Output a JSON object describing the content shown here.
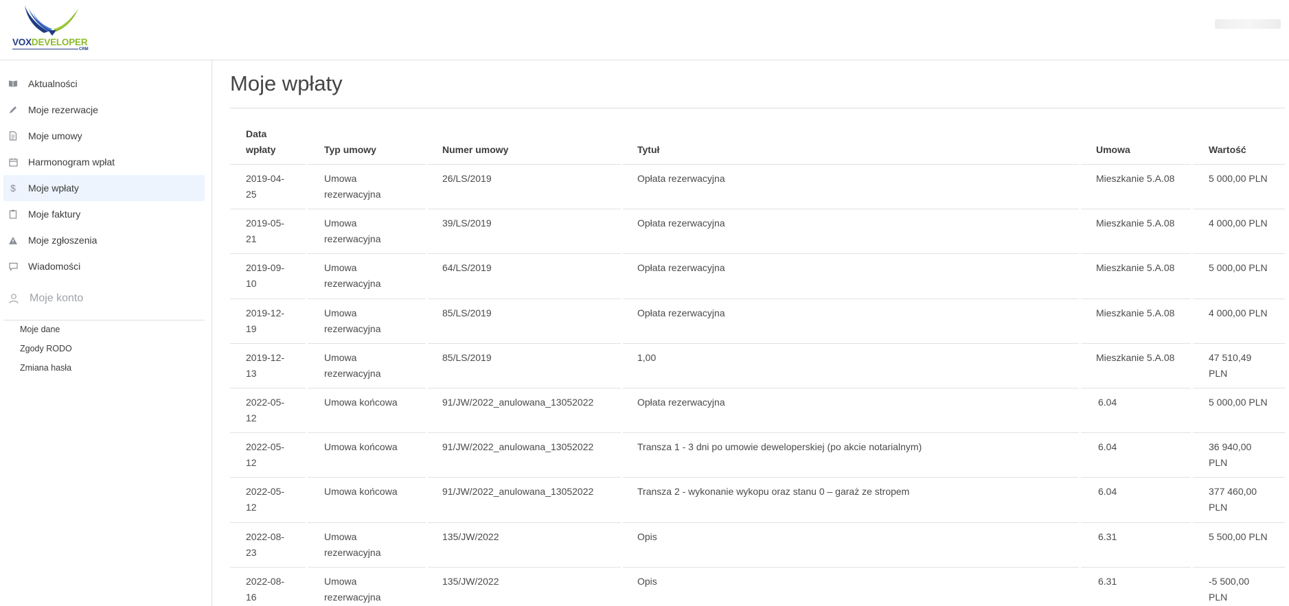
{
  "brand": {
    "part1": "VOX",
    "part2": "DEVELOPER",
    "sub": "CRM"
  },
  "sidebar": {
    "items": [
      {
        "label": "Aktualności",
        "icon": "book-icon"
      },
      {
        "label": "Moje rezerwacje",
        "icon": "pencil-icon"
      },
      {
        "label": "Moje umowy",
        "icon": "document-icon"
      },
      {
        "label": "Harmonogram wpłat",
        "icon": "calendar-icon"
      },
      {
        "label": "Moje wpłaty",
        "icon": "dollar-icon",
        "active": true
      },
      {
        "label": "Moje faktury",
        "icon": "clipboard-icon"
      },
      {
        "label": "Moje zgłoszenia",
        "icon": "warning-icon"
      },
      {
        "label": "Wiadomości",
        "icon": "chat-icon"
      }
    ],
    "account": {
      "label": "Moje konto",
      "icon": "user-icon",
      "items": [
        "Moje dane",
        "Zgody RODO",
        "Zmiana hasła"
      ]
    }
  },
  "main": {
    "title": "Moje wpłaty",
    "table": {
      "headers": {
        "date_line1": "Data",
        "date_line2": "wpłaty",
        "type": "Typ umowy",
        "number": "Numer umowy",
        "title": "Tytuł",
        "contract": "Umowa",
        "value": "Wartość"
      },
      "rows": [
        {
          "date1": "2019-04-",
          "date2": "25",
          "type1": "Umowa",
          "type2": "rezerwacyjna",
          "number": "26/LS/2019",
          "title": "Opłata rezerwacyjna",
          "contract": "Mieszkanie 5.A.08",
          "value1": "5 000,00 PLN",
          "value2": ""
        },
        {
          "date1": "2019-05-",
          "date2": "21",
          "type1": "Umowa",
          "type2": "rezerwacyjna",
          "number": "39/LS/2019",
          "title": "Opłata rezerwacyjna",
          "contract": "Mieszkanie 5.A.08",
          "value1": "4 000,00 PLN",
          "value2": ""
        },
        {
          "date1": "2019-09-",
          "date2": "10",
          "type1": "Umowa",
          "type2": "rezerwacyjna",
          "number": "64/LS/2019",
          "title": "Opłata rezerwacyjna",
          "contract": "Mieszkanie 5.A.08",
          "value1": "5 000,00 PLN",
          "value2": ""
        },
        {
          "date1": "2019-12-",
          "date2": "19",
          "type1": "Umowa",
          "type2": "rezerwacyjna",
          "number": "85/LS/2019",
          "title": "Opłata rezerwacyjna",
          "contract": "Mieszkanie 5.A.08",
          "value1": "4 000,00 PLN",
          "value2": ""
        },
        {
          "date1": "2019-12-",
          "date2": "13",
          "type1": "Umowa",
          "type2": "rezerwacyjna",
          "number": "85/LS/2019",
          "title": "1,00",
          "contract": "Mieszkanie 5.A.08",
          "value1": "47 510,49",
          "value2": "PLN"
        },
        {
          "date1": "2022-05-",
          "date2": "12",
          "type1": "Umowa końcowa",
          "type2": "",
          "number": "91/JW/2022_anulowana_13052022",
          "title": "Opłata rezerwacyjna",
          "contract": "6.04",
          "value1": "5 000,00 PLN",
          "value2": ""
        },
        {
          "date1": "2022-05-",
          "date2": "12",
          "type1": "Umowa końcowa",
          "type2": "",
          "number": "91/JW/2022_anulowana_13052022",
          "title": "Transza 1 - 3 dni po umowie deweloperskiej (po akcie notarialnym)",
          "contract": "6.04",
          "value1": "36 940,00",
          "value2": "PLN"
        },
        {
          "date1": "2022-05-",
          "date2": "12",
          "type1": "Umowa końcowa",
          "type2": "",
          "number": "91/JW/2022_anulowana_13052022",
          "title": "Transza 2 - wykonanie wykopu oraz stanu 0 – garaż ze stropem",
          "contract": "6.04",
          "value1": "377 460,00",
          "value2": "PLN"
        },
        {
          "date1": "2022-08-",
          "date2": "23",
          "type1": "Umowa",
          "type2": "rezerwacyjna",
          "number": "135/JW/2022",
          "title": "Opis",
          "contract": "6.31",
          "value1": "5 500,00 PLN",
          "value2": ""
        },
        {
          "date1": "2022-08-",
          "date2": "16",
          "type1": "Umowa",
          "type2": "rezerwacyjna",
          "number": "135/JW/2022",
          "title": "Opis",
          "contract": "6.31",
          "value1": "-5 500,00",
          "value2": "PLN"
        }
      ]
    }
  }
}
